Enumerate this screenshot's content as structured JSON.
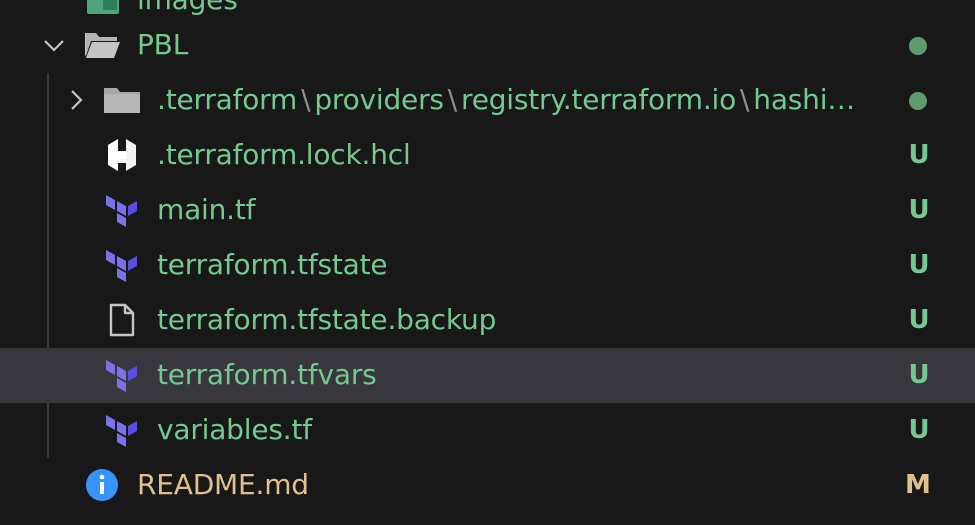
{
  "colors": {
    "background": "#181818",
    "selected_row": "#37373d",
    "untracked_green": "#73c991",
    "modified_orange": "#e2c08d",
    "info_blue": "#3794ff",
    "terraform_purple": "#7b72e9",
    "folder_gray": "#c5c5c5"
  },
  "tree": {
    "partial_top_label": "images",
    "pbl": {
      "name": "PBL",
      "icon": "folder-open-icon"
    },
    "terraform_dir": {
      "segments": [
        ".terraform",
        "providers",
        "registry.terraform.io",
        "hashi…"
      ],
      "separator": "\\",
      "icon": "folder-icon"
    },
    "files": [
      {
        "name": ".terraform.lock.hcl",
        "icon": "hashicorp-icon",
        "badge": "U"
      },
      {
        "name": "main.tf",
        "icon": "terraform-icon",
        "badge": "U"
      },
      {
        "name": "terraform.tfstate",
        "icon": "terraform-icon",
        "badge": "U"
      },
      {
        "name": "terraform.tfstate.backup",
        "icon": "file-icon",
        "badge": "U"
      },
      {
        "name": "terraform.tfvars",
        "icon": "terraform-icon",
        "badge": "U"
      },
      {
        "name": "variables.tf",
        "icon": "terraform-icon",
        "badge": "U"
      }
    ],
    "readme": {
      "name": "README.md",
      "icon": "info-icon",
      "badge": "M"
    }
  }
}
